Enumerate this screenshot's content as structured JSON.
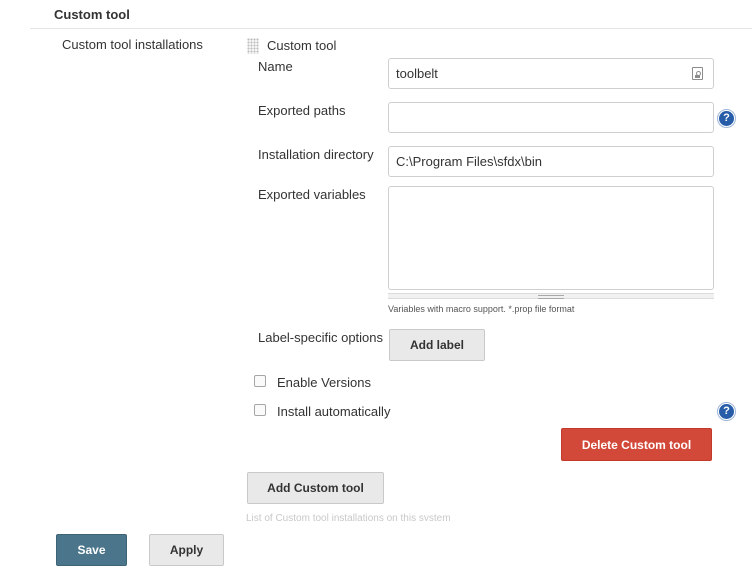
{
  "section": {
    "title": "Custom tool"
  },
  "installations": {
    "label": "Custom tool installations",
    "tool": {
      "title": "Custom tool",
      "fields": {
        "name": {
          "label": "Name",
          "value": "toolbelt"
        },
        "exported_paths": {
          "label": "Exported paths",
          "value": ""
        },
        "install_dir": {
          "label": "Installation directory",
          "value": "C:\\Program Files\\sfdx\\bin"
        },
        "exported_vars": {
          "label": "Exported variables",
          "value": "",
          "hint": "Variables with macro support. *.prop file format"
        }
      },
      "label_options": {
        "label": "Label-specific options",
        "button": "Add label"
      },
      "enable_versions": {
        "label": "Enable Versions",
        "checked": false
      },
      "install_auto": {
        "label": "Install automatically",
        "checked": false
      },
      "delete_button": "Delete Custom tool"
    },
    "add_button": "Add Custom tool",
    "list_hint": "List of Custom tool installations on this system"
  },
  "footer": {
    "save": "Save",
    "apply": "Apply"
  },
  "colors": {
    "primary": "#4b758b",
    "danger": "#d24939",
    "help": "#275da8"
  }
}
